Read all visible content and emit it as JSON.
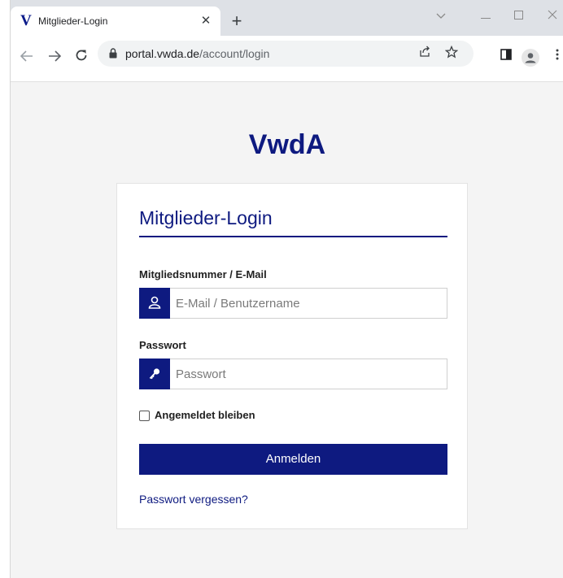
{
  "browser": {
    "tab": {
      "title": "Mitglieder-Login",
      "favicon": "V"
    },
    "url": {
      "domain": "portal.vwda.de",
      "path": "/account/login"
    }
  },
  "page": {
    "brand": "VwdA",
    "login": {
      "title": "Mitglieder-Login",
      "username": {
        "label": "Mitgliedsnummer / E-Mail",
        "placeholder": "E-Mail / Benutzername",
        "value": ""
      },
      "password": {
        "label": "Passwort",
        "placeholder": "Passwort",
        "value": ""
      },
      "remember_label": "Angemeldet bleiben",
      "submit_label": "Anmelden",
      "forgot_label": "Passwort vergessen?"
    }
  },
  "colors": {
    "brand": "#0e1a80",
    "page_background": "#f4f4f4"
  }
}
